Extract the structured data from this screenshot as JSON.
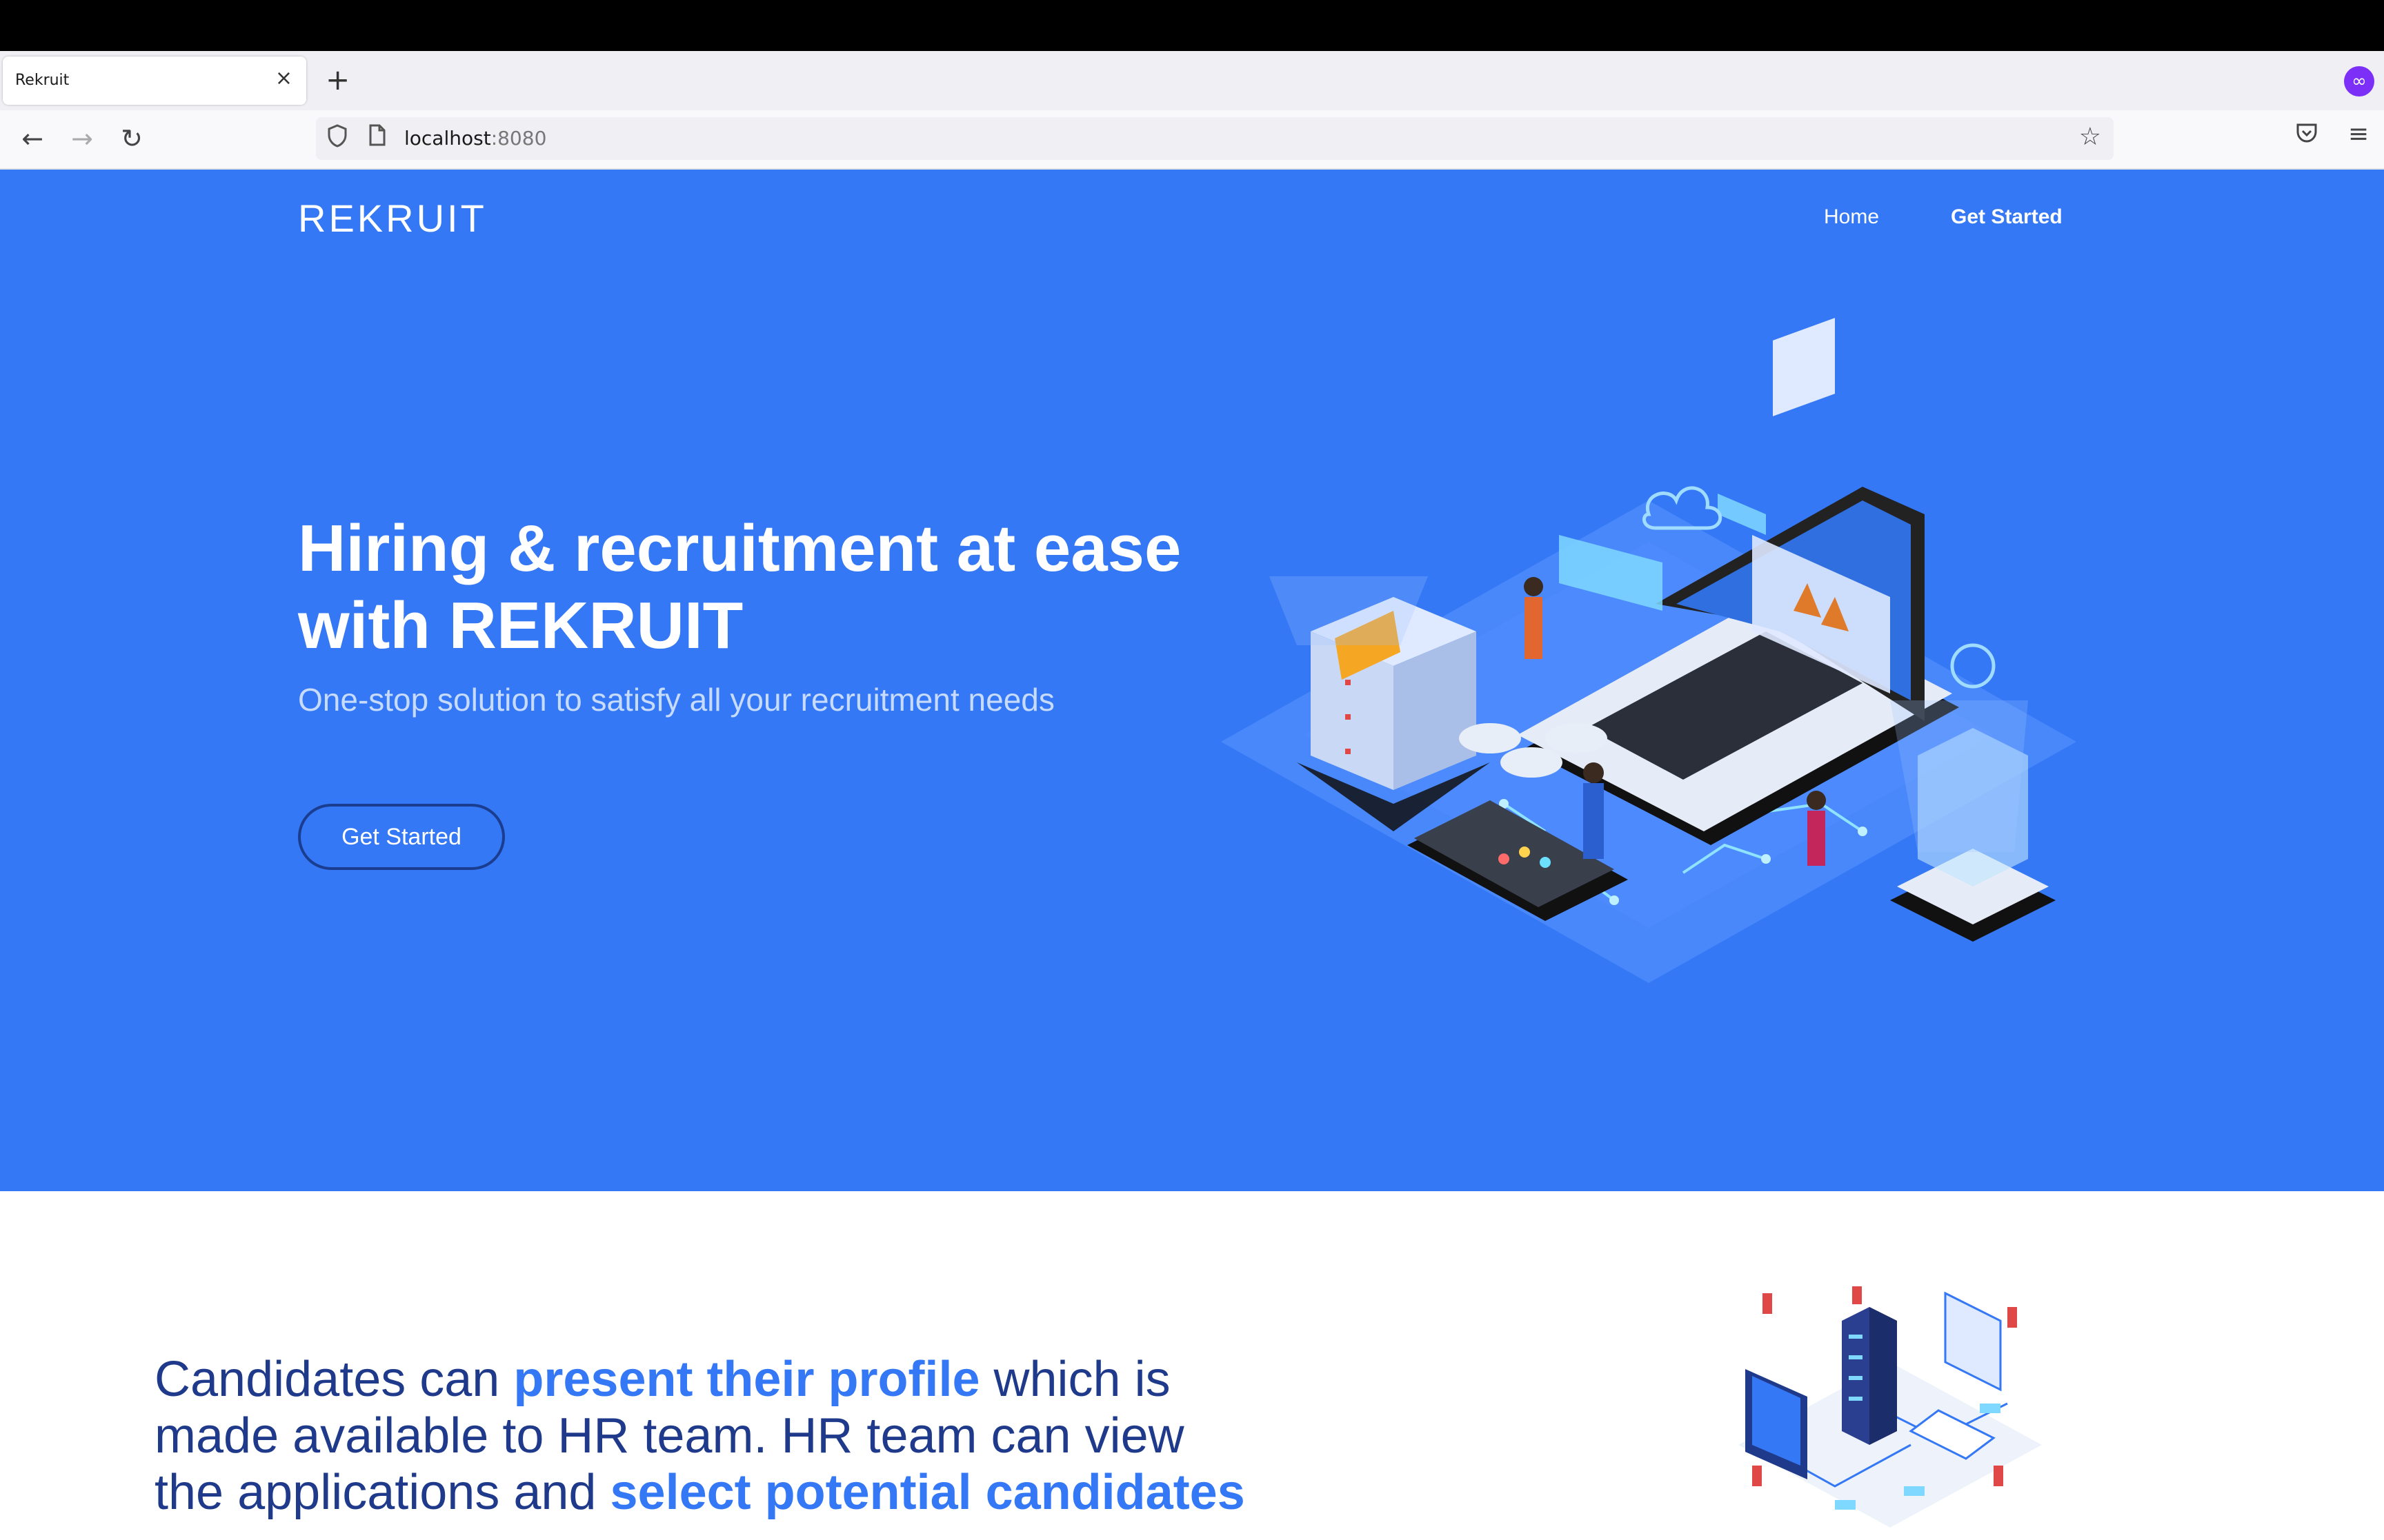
{
  "browser": {
    "tab_title": "Rekruit",
    "tab_close": "×",
    "new_tab": "+",
    "url_host": "localhost",
    "url_port": ":8080",
    "back": "←",
    "forward": "→",
    "reload": "↻",
    "star": "☆",
    "menu": "≡",
    "pocket": "⛉",
    "profile": "∞"
  },
  "header": {
    "logo": "REKRUIT",
    "nav": {
      "home": "Home",
      "get_started": "Get Started"
    }
  },
  "hero": {
    "title": "Hiring & recruitment at ease with REKRUIT",
    "subtitle": "One-stop solution to satisfy all your recruitment needs",
    "cta": "Get Started"
  },
  "features": {
    "text_1": "Candidates can ",
    "highlight_1": "present their profile",
    "text_2": " which is made available to HR team. HR team can view the applications and ",
    "highlight_2": "select potential candidates"
  },
  "colors": {
    "hero_bg": "#3578f6",
    "accent": "#3578f6",
    "text_dark": "#1f3a8a"
  }
}
